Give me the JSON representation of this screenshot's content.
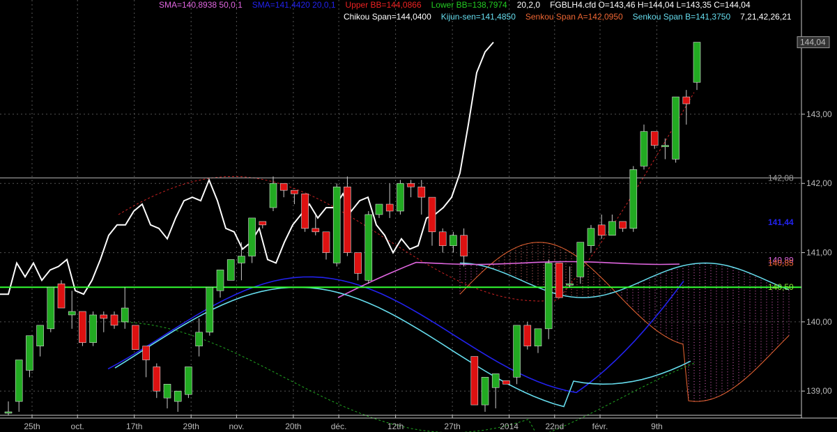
{
  "header": {
    "line1": [
      {
        "text": "SMA=140,8938  50,0,1",
        "color": "#e066e0"
      },
      {
        "text": "SMA=141,4420  20,0,1",
        "color": "#2222ee"
      },
      {
        "text": "Upper BB=144,0866",
        "color": "#ee2222"
      },
      {
        "text": "Lower BB=138,7974",
        "color": "#22cc22"
      },
      {
        "text": "20,2,0",
        "color": "#ffffff"
      },
      {
        "text": "FGBLH4.cfd O=143,46 H=144,04 L=143,35 C=144,04",
        "color": "#ffffff"
      }
    ],
    "line2": [
      {
        "text": "Chikou Span=144,0400",
        "color": "#ffffff"
      },
      {
        "text": "Kijun-sen=141,4850",
        "color": "#66ddee"
      },
      {
        "text": "Senkou Span A=142,0950",
        "color": "#ee6633"
      },
      {
        "text": "Senkou Span B=141,3750",
        "color": "#66ddee"
      },
      {
        "text": "7,21,42,26,21",
        "color": "#ffffff"
      }
    ]
  },
  "chart_data": {
    "type": "candlestick",
    "ylim": [
      138.65,
      144.65
    ],
    "yticks": [
      {
        "value": 139.0,
        "label": "139,00"
      },
      {
        "value": 140.0,
        "label": "140,00"
      },
      {
        "value": 141.0,
        "label": "141,00"
      },
      {
        "value": 142.0,
        "label": "142,00"
      },
      {
        "value": 143.0,
        "label": "143,00"
      }
    ],
    "xticks": [
      {
        "index": 0,
        "label": "25th"
      },
      {
        "index": 4,
        "label": "oct."
      },
      {
        "index": 9,
        "label": "17th"
      },
      {
        "index": 14,
        "label": "29th"
      },
      {
        "index": 18,
        "label": "nov."
      },
      {
        "index": 23,
        "label": "20th"
      },
      {
        "index": 27,
        "label": "déc."
      },
      {
        "index": 32,
        "label": "12th"
      },
      {
        "index": 37,
        "label": "27th"
      },
      {
        "index": 42,
        "label": "2014"
      },
      {
        "index": 46,
        "label": "22nd"
      },
      {
        "index": 50,
        "label": "févr."
      },
      {
        "index": 55,
        "label": "9th"
      }
    ],
    "bar_count": 60,
    "price_labels": [
      {
        "value": 144.04,
        "label": "144,04",
        "color": "#bbbbbb",
        "boxed": true
      },
      {
        "value": 142.08,
        "label": "142,08",
        "color": "#999999",
        "boxed": false
      },
      {
        "value": 141.44,
        "label": "141,44",
        "color": "#2222ee",
        "boxed": false
      },
      {
        "value": 140.89,
        "label": "140,89",
        "color": "#e066e0",
        "boxed": false
      },
      {
        "value": 140.85,
        "label": "140,85",
        "color": "#ee6633",
        "boxed": false
      },
      {
        "value": 140.5,
        "label": "140,50",
        "color": "#88ee33",
        "boxed": false
      }
    ],
    "horizontal_lines": [
      {
        "value": 142.08,
        "color": "#bbbbbb"
      },
      {
        "value": 140.5,
        "color": "#33ff33"
      }
    ],
    "candles": [
      [
        138.7,
        138.85,
        138.65,
        138.7
      ],
      [
        138.85,
        139.45,
        138.7,
        139.45
      ],
      [
        139.3,
        139.8,
        139.2,
        139.8
      ],
      [
        139.65,
        139.95,
        139.5,
        139.95
      ],
      [
        139.9,
        140.5,
        139.85,
        140.5
      ],
      [
        140.55,
        140.6,
        140.2,
        140.2
      ],
      [
        140.1,
        140.45,
        139.9,
        140.15
      ],
      [
        140.15,
        140.15,
        139.65,
        139.7
      ],
      [
        139.7,
        140.15,
        139.65,
        140.1
      ],
      [
        140.1,
        140.15,
        139.85,
        140.05
      ],
      [
        140.1,
        140.15,
        139.9,
        139.95
      ],
      [
        140.0,
        140.5,
        139.9,
        140.2
      ],
      [
        139.95,
        139.95,
        139.6,
        139.6
      ],
      [
        139.65,
        139.65,
        139.2,
        139.45
      ],
      [
        139.35,
        139.4,
        138.9,
        139.0
      ],
      [
        138.9,
        139.1,
        138.75,
        139.1
      ],
      [
        138.85,
        139.0,
        138.7,
        139.0
      ],
      [
        138.95,
        139.35,
        138.9,
        139.35
      ],
      [
        139.65,
        140.05,
        139.5,
        139.85
      ],
      [
        139.85,
        140.5,
        139.8,
        140.5
      ],
      [
        140.45,
        140.75,
        140.35,
        140.75
      ],
      [
        140.6,
        140.9,
        140.6,
        140.9
      ],
      [
        140.85,
        141.15,
        140.6,
        140.95
      ],
      [
        140.95,
        141.5,
        140.85,
        141.5
      ],
      [
        141.45,
        141.4,
        141.35,
        141.4
      ],
      [
        141.65,
        142.1,
        141.6,
        142.0
      ],
      [
        142.0,
        142.0,
        141.8,
        141.9
      ],
      [
        141.9,
        141.9,
        141.7,
        141.85
      ],
      [
        141.85,
        141.6,
        141.3,
        141.35
      ],
      [
        141.35,
        141.55,
        141.25,
        141.3
      ],
      [
        141.3,
        141.2,
        140.9,
        141.0
      ],
      [
        140.85,
        142.0,
        140.8,
        141.95
      ],
      [
        141.95,
        142.1,
        140.95,
        141.0
      ],
      [
        141.0,
        141.0,
        140.6,
        140.7
      ],
      [
        140.6,
        141.6,
        140.55,
        141.55
      ],
      [
        141.55,
        141.7,
        141.5,
        141.7
      ],
      [
        141.7,
        142.0,
        141.5,
        141.6
      ],
      [
        141.6,
        142.05,
        141.55,
        142.0
      ],
      [
        142.0,
        142.05,
        141.8,
        141.95
      ],
      [
        141.95,
        142.05,
        141.55,
        141.8
      ],
      [
        141.8,
        141.35,
        141.1,
        141.3
      ],
      [
        141.3,
        141.35,
        141.0,
        141.1
      ],
      [
        141.1,
        141.3,
        141.0,
        141.25
      ],
      [
        141.25,
        141.35,
        140.8,
        140.95
      ],
      [
        140.95,
        140.95,
        140.8,
        140.9
      ],
      [
        140.75,
        141.0,
        140.7,
        141.0
      ],
      [
        141.05,
        141.1,
        140.6,
        140.7
      ],
      [
        140.7,
        140.85,
        140.5,
        140.8
      ],
      [
        140.8,
        140.9,
        140.3,
        140.4
      ],
      [
        140.5,
        140.5,
        140.3,
        140.3
      ],
      [
        140.3,
        140.5,
        140.3,
        140.45
      ],
      [
        140.5,
        140.55,
        140.3,
        140.4
      ],
      [
        140.4,
        140.5,
        140.35,
        140.5
      ],
      [
        140.55,
        140.7,
        140.35,
        140.5
      ],
      [
        140.5,
        140.55,
        139.95,
        140.2
      ],
      [
        139.95,
        140.05,
        139.5,
        139.95
      ],
      [
        139.8,
        140.05,
        139.7,
        139.8
      ],
      [
        140.3,
        140.35,
        140.25,
        140.3
      ],
      [
        140.3,
        140.3,
        139.9,
        140.0
      ],
      [
        139.95,
        140.0,
        139.7,
        139.75
      ]
    ],
    "candles_right": [
      [
        139.5,
        139.5,
        138.8,
        138.8
      ],
      [
        138.8,
        139.2,
        138.7,
        139.2
      ],
      [
        139.05,
        139.25,
        138.75,
        139.25
      ],
      [
        139.15,
        139.15,
        139.1,
        139.1
      ],
      [
        139.2,
        139.95,
        139.1,
        139.95
      ],
      [
        139.95,
        140.0,
        139.6,
        139.65
      ],
      [
        139.65,
        139.9,
        139.55,
        139.9
      ],
      [
        139.9,
        140.9,
        139.75,
        140.85
      ],
      [
        140.85,
        140.55,
        140.35,
        140.35
      ],
      [
        140.55,
        140.8,
        140.5,
        140.55
      ],
      [
        140.65,
        141.15,
        140.55,
        141.15
      ],
      [
        141.1,
        141.4,
        141.0,
        141.35
      ],
      [
        141.4,
        141.55,
        141.2,
        141.25
      ],
      [
        141.25,
        141.55,
        141.25,
        141.45
      ],
      [
        141.45,
        141.45,
        141.3,
        141.35
      ],
      [
        141.35,
        142.25,
        141.3,
        142.2
      ],
      [
        142.25,
        142.85,
        142.2,
        142.75
      ],
      [
        142.75,
        142.65,
        142.5,
        142.55
      ],
      [
        142.55,
        142.65,
        142.35,
        142.55
      ],
      [
        142.35,
        143.25,
        142.3,
        143.25
      ],
      [
        143.25,
        143.35,
        142.85,
        143.15
      ],
      [
        143.46,
        144.04,
        143.35,
        144.04
      ]
    ],
    "chikou_span": [
      140.4,
      140.4,
      140.85,
      140.65,
      140.85,
      140.6,
      140.75,
      140.8,
      140.9,
      140.45,
      140.4,
      140.6,
      140.9,
      141.25,
      141.4,
      141.4,
      141.6,
      141.7,
      141.4,
      141.35,
      141.2,
      141.5,
      141.75,
      141.8,
      141.75,
      142.05,
      141.75,
      141.35,
      141.3,
      141.05,
      141.15,
      141.35,
      140.9,
      140.85,
      141.15,
      141.4,
      141.55,
      141.7,
      141.5,
      141.65,
      141.65,
      141.85,
      141.6,
      141.75,
      141.8,
      141.4,
      141.25,
      141.0,
      141.2,
      141.05,
      141.1,
      141.5,
      141.55,
      141.65,
      141.8,
      142.15,
      142.85,
      143.6,
      143.9,
      144.04
    ]
  }
}
